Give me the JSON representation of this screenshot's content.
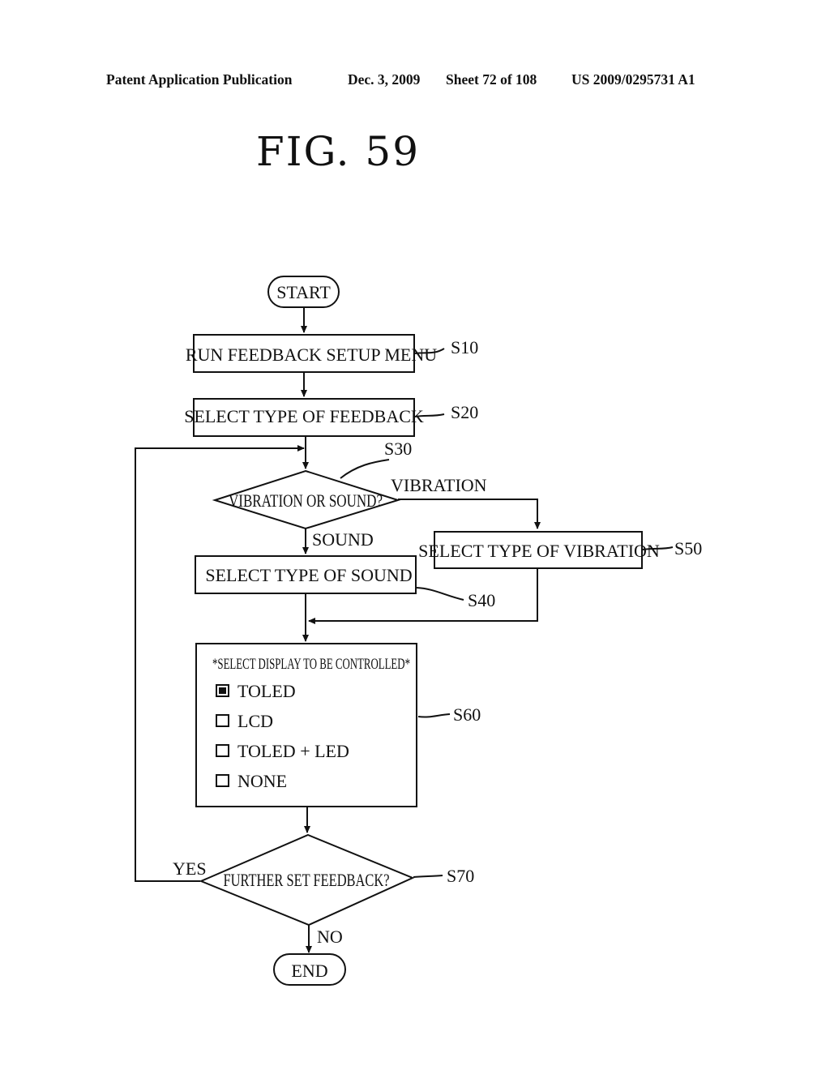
{
  "header": {
    "publication": "Patent Application Publication",
    "date": "Dec. 3, 2009",
    "sheet": "Sheet 72 of 108",
    "number": "US 2009/0295731 A1"
  },
  "figure": {
    "title": "FIG. 59"
  },
  "flowchart": {
    "start": "START",
    "end": "END",
    "steps": {
      "s10": {
        "label": "RUN FEEDBACK SETUP MENU",
        "ref": "S10"
      },
      "s20": {
        "label": "SELECT TYPE OF FEEDBACK",
        "ref": "S20"
      },
      "s30": {
        "label": "VIBRATION OR SOUND?",
        "ref": "S30",
        "branch_right": "VIBRATION",
        "branch_down": "SOUND"
      },
      "s40": {
        "label": "SELECT TYPE OF SOUND",
        "ref": "S40"
      },
      "s50": {
        "label": "SELECT TYPE OF VIBRATION",
        "ref": "S50"
      },
      "s60": {
        "ref": "S60",
        "heading": "*SELECT DISPLAY TO BE CONTROLLED*",
        "options": [
          {
            "label": "TOLED",
            "checked": true
          },
          {
            "label": "LCD",
            "checked": false
          },
          {
            "label": "TOLED + LED",
            "checked": false
          },
          {
            "label": "NONE",
            "checked": false
          }
        ]
      },
      "s70": {
        "label": "FURTHER SET FEEDBACK?",
        "ref": "S70",
        "branch_left": "YES",
        "branch_down": "NO"
      }
    }
  }
}
